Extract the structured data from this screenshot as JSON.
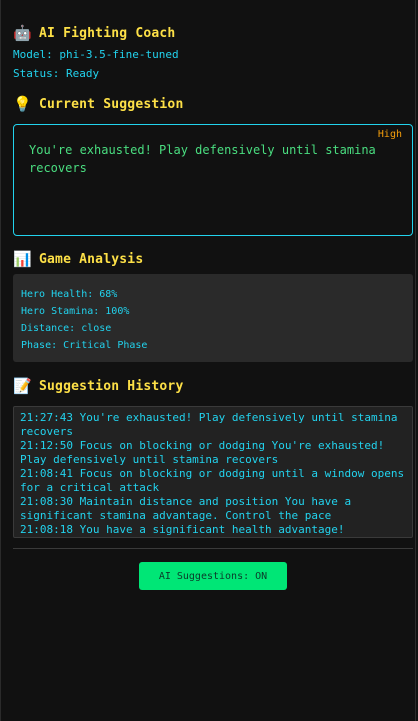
{
  "app": {
    "title": "AI Fighting Coach",
    "title_icon": "robot-icon",
    "model": "Model: phi-3.5-fine-tuned",
    "status": "Status: Ready"
  },
  "current_suggestion": {
    "heading": "Current Suggestion",
    "icon": "lightbulb-icon",
    "priority": "High",
    "text": "You're exhausted! Play defensively until stamina recovers"
  },
  "game_analysis": {
    "heading": "Game Analysis",
    "icon": "bar-chart-icon",
    "hero_health": "Hero Health: 68%",
    "hero_stamina": "Hero Stamina: 100%",
    "distance": "Distance: close",
    "phase": "Phase: Critical Phase"
  },
  "history": {
    "heading": "Suggestion History",
    "icon": "memo-icon",
    "items": [
      "21:27:43 You're exhausted! Play defensively until stamina recovers",
      "21:12:50 Focus on blocking or dodging You're exhausted! Play defensively until stamina recovers",
      "21:08:41 Focus on blocking or dodging until a window opens for a critical attack",
      "21:08:30 Maintain distance and position You have a significant stamina advantage. Control the pace",
      "21:08:18 You have a significant health advantage!"
    ]
  },
  "controls": {
    "toggle_label": "AI Suggestions: ON"
  },
  "colors": {
    "accent": "#22d3ee",
    "heading": "#fde047",
    "suggestion_text": "#4ade80",
    "priority_high": "#f59e0b",
    "toggle_bg": "#00e676"
  }
}
